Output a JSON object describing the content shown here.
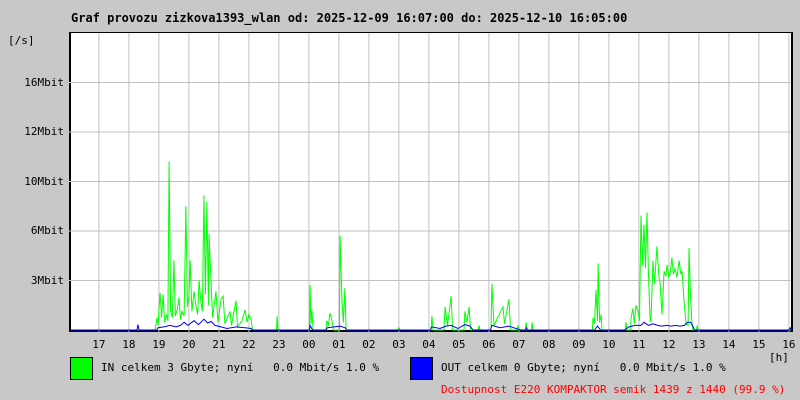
{
  "title": "Graf provozu zizkova1393_wlan od: 2025-12-09 16:07:00 do: 2025-12-10 16:05:00",
  "chart": {
    "y_unit": "[/s]",
    "x_unit": "[h]"
  },
  "legend": {
    "in_label": "IN celkem 3 Gbyte; nyní   0.0 Mbit/s 1.0 %",
    "out_label": "OUT celkem 0 Gbyte; nyní   0.0 Mbit/s 1.0 %",
    "availability": "Dostupnost E220 KOMPAKTOR semik 1439 z 1440 (99.9 %)",
    "in_color": "#00ff00",
    "out_color": "#0000ff",
    "availability_color": "#ff0000"
  },
  "colors": {
    "page_bg": "#c8c8c8",
    "plot_bg": "#ffffff",
    "grid": "#c0c0c0",
    "frame": "#000000"
  },
  "chart_data": {
    "type": "line",
    "title": "Graf provozu zizkova1393_wlan od: 2025-12-09 16:07:00 do: 2025-12-10 16:05:00",
    "xlabel": "[h]",
    "ylabel": "[/s]",
    "xlim_hours": [
      0,
      24
    ],
    "ylim": [
      0,
      19.2
    ],
    "grid": true,
    "grid_color": "#c0c0c0",
    "x_tick_labels": [
      "17",
      "18",
      "19",
      "20",
      "21",
      "22",
      "23",
      "00",
      "01",
      "02",
      "03",
      "04",
      "05",
      "06",
      "07",
      "08",
      "09",
      "10",
      "11",
      "12",
      "13",
      "14",
      "15",
      "16"
    ],
    "x_tick_start_offset_hours": 0.93,
    "x_tick_step_hours": 1,
    "y_ticks": [
      {
        "label": "3Mbit",
        "value": 3.2
      },
      {
        "label": "6Mbit",
        "value": 6.4
      },
      {
        "label": "10Mbit",
        "value": 9.6
      },
      {
        "label": "12Mbit",
        "value": 12.8
      },
      {
        "label": "16Mbit",
        "value": 16.0
      }
    ],
    "series": [
      {
        "name": "IN",
        "color": "#00ff00",
        "unit": "Mbit/s",
        "points": [
          [
            0,
            0
          ],
          [
            2.8,
            0
          ],
          [
            2.87,
            0.8
          ],
          [
            2.9,
            0.3
          ],
          [
            2.97,
            2.4
          ],
          [
            3.02,
            0.8
          ],
          [
            3.07,
            2.3
          ],
          [
            3.12,
            0.5
          ],
          [
            3.18,
            1.0
          ],
          [
            3.23,
            0.6
          ],
          [
            3.27,
            10.9
          ],
          [
            3.32,
            1.2
          ],
          [
            3.38,
            0.8
          ],
          [
            3.43,
            4.5
          ],
          [
            3.48,
            0.9
          ],
          [
            3.55,
            1.4
          ],
          [
            3.6,
            2.1
          ],
          [
            3.65,
            0.7
          ],
          [
            3.7,
            1.2
          ],
          [
            3.77,
            0.9
          ],
          [
            3.83,
            8.0
          ],
          [
            3.88,
            1.5
          ],
          [
            3.93,
            2.2
          ],
          [
            3.97,
            4.5
          ],
          [
            4.03,
            1.2
          ],
          [
            4.1,
            2.5
          ],
          [
            4.17,
            1.5
          ],
          [
            4.22,
            1.0
          ],
          [
            4.27,
            3.2
          ],
          [
            4.33,
            1.8
          ],
          [
            4.38,
            1.2
          ],
          [
            4.43,
            8.7
          ],
          [
            4.48,
            2.3
          ],
          [
            4.53,
            8.3
          ],
          [
            4.58,
            1.6
          ],
          [
            4.6,
            6.2
          ],
          [
            4.67,
            3.0
          ],
          [
            4.72,
            0.8
          ],
          [
            4.83,
            2.5
          ],
          [
            4.9,
            0.5
          ],
          [
            5.0,
            2.0
          ],
          [
            5.07,
            2.2
          ],
          [
            5.13,
            0.4
          ],
          [
            5.3,
            1.2
          ],
          [
            5.35,
            0.3
          ],
          [
            5.5,
            1.9
          ],
          [
            5.55,
            0.2
          ],
          [
            5.7,
            0.6
          ],
          [
            5.8,
            1.3
          ],
          [
            5.87,
            0.5
          ],
          [
            5.93,
            1.0
          ],
          [
            6.0,
            0.7
          ],
          [
            6.05,
            0
          ],
          [
            6.85,
            0
          ],
          [
            6.87,
            0.9
          ],
          [
            6.9,
            0
          ],
          [
            7.95,
            0
          ],
          [
            7.97,
            2.9
          ],
          [
            8.0,
            0.4
          ],
          [
            8.03,
            1.3
          ],
          [
            8.07,
            0
          ],
          [
            8.5,
            0
          ],
          [
            8.53,
            0.6
          ],
          [
            8.58,
            0.3
          ],
          [
            8.63,
            1.1
          ],
          [
            8.7,
            0.6
          ],
          [
            8.75,
            0
          ],
          [
            8.95,
            0
          ],
          [
            8.97,
            6.1
          ],
          [
            9.03,
            2.0
          ],
          [
            9.08,
            0.5
          ],
          [
            9.13,
            2.7
          ],
          [
            9.17,
            0
          ],
          [
            10.9,
            0
          ],
          [
            10.93,
            0.15
          ],
          [
            10.97,
            0
          ],
          [
            12.0,
            0
          ],
          [
            12.03,
            0.9
          ],
          [
            12.07,
            0
          ],
          [
            12.43,
            0
          ],
          [
            12.47,
            1.5
          ],
          [
            12.55,
            0.3
          ],
          [
            12.67,
            2.2
          ],
          [
            12.72,
            0
          ],
          [
            13.1,
            0
          ],
          [
            13.13,
            1.2
          ],
          [
            13.2,
            0.5
          ],
          [
            13.27,
            1.5
          ],
          [
            13.32,
            0
          ],
          [
            13.57,
            0
          ],
          [
            13.6,
            0.3
          ],
          [
            13.63,
            0
          ],
          [
            14.0,
            0
          ],
          [
            14.03,
            3.0
          ],
          [
            14.1,
            0.3
          ],
          [
            14.4,
            1.5
          ],
          [
            14.45,
            0.4
          ],
          [
            14.6,
            2.0
          ],
          [
            14.65,
            0
          ],
          [
            14.87,
            0
          ],
          [
            14.9,
            0.3
          ],
          [
            14.93,
            0
          ],
          [
            15.15,
            0
          ],
          [
            15.17,
            0.5
          ],
          [
            15.2,
            0
          ],
          [
            15.35,
            0
          ],
          [
            15.37,
            0.5
          ],
          [
            15.4,
            0
          ],
          [
            17.38,
            0
          ],
          [
            17.4,
            0.8
          ],
          [
            17.45,
            0.4
          ],
          [
            17.5,
            2.6
          ],
          [
            17.55,
            0.6
          ],
          [
            17.57,
            4.3
          ],
          [
            17.62,
            0.5
          ],
          [
            17.67,
            1.0
          ],
          [
            17.7,
            0
          ],
          [
            18.47,
            0
          ],
          [
            18.5,
            0.5
          ],
          [
            18.53,
            0
          ],
          [
            18.65,
            0
          ],
          [
            18.67,
            0.8
          ],
          [
            18.73,
            1.4
          ],
          [
            18.78,
            0.4
          ],
          [
            18.83,
            1.6
          ],
          [
            18.9,
            1.2
          ],
          [
            18.95,
            0.6
          ],
          [
            19.0,
            7.4
          ],
          [
            19.05,
            4.2
          ],
          [
            19.1,
            6.8
          ],
          [
            19.15,
            4.0
          ],
          [
            19.2,
            7.6
          ],
          [
            19.25,
            3.5
          ],
          [
            19.3,
            0.8
          ],
          [
            19.33,
            0.5
          ],
          [
            19.4,
            4.5
          ],
          [
            19.45,
            3.0
          ],
          [
            19.53,
            5.4
          ],
          [
            19.6,
            3.4
          ],
          [
            19.63,
            3.2
          ],
          [
            19.7,
            1.0
          ],
          [
            19.77,
            3.8
          ],
          [
            19.83,
            3.5
          ],
          [
            19.87,
            4.2
          ],
          [
            19.93,
            3.4
          ],
          [
            19.97,
            3.6
          ],
          [
            20.03,
            4.7
          ],
          [
            20.08,
            3.6
          ],
          [
            20.13,
            4.0
          ],
          [
            20.2,
            3.4
          ],
          [
            20.27,
            4.5
          ],
          [
            20.33,
            3.6
          ],
          [
            20.37,
            3.8
          ],
          [
            20.43,
            2.0
          ],
          [
            20.5,
            0.4
          ],
          [
            20.57,
            0.3
          ],
          [
            20.6,
            5.3
          ],
          [
            20.65,
            2.2
          ],
          [
            20.7,
            0.4
          ],
          [
            20.73,
            0
          ],
          [
            20.85,
            0
          ],
          [
            20.87,
            0.3
          ],
          [
            20.9,
            0
          ],
          [
            24,
            0
          ]
        ]
      },
      {
        "name": "OUT",
        "color": "#0000ff",
        "unit": "Mbit/s",
        "points": [
          [
            0,
            0
          ],
          [
            2.2,
            0
          ],
          [
            2.23,
            0.35
          ],
          [
            2.27,
            0
          ],
          [
            2.85,
            0
          ],
          [
            2.9,
            0.15
          ],
          [
            3.1,
            0.2
          ],
          [
            3.3,
            0.3
          ],
          [
            3.5,
            0.2
          ],
          [
            3.65,
            0.3
          ],
          [
            3.77,
            0.5
          ],
          [
            3.9,
            0.3
          ],
          [
            4.1,
            0.6
          ],
          [
            4.25,
            0.35
          ],
          [
            4.43,
            0.7
          ],
          [
            4.55,
            0.45
          ],
          [
            4.67,
            0.55
          ],
          [
            4.8,
            0.3
          ],
          [
            5.0,
            0.2
          ],
          [
            5.2,
            0.1
          ],
          [
            5.5,
            0.2
          ],
          [
            5.8,
            0.15
          ],
          [
            6.0,
            0.1
          ],
          [
            6.05,
            0
          ],
          [
            7.95,
            0
          ],
          [
            7.97,
            0.3
          ],
          [
            8.05,
            0
          ],
          [
            8.5,
            0
          ],
          [
            8.55,
            0.15
          ],
          [
            8.97,
            0.25
          ],
          [
            9.13,
            0.15
          ],
          [
            9.2,
            0
          ],
          [
            11.98,
            0
          ],
          [
            12.03,
            0.2
          ],
          [
            12.3,
            0.1
          ],
          [
            12.5,
            0.25
          ],
          [
            12.67,
            0.3
          ],
          [
            12.9,
            0.1
          ],
          [
            13.13,
            0.35
          ],
          [
            13.3,
            0.25
          ],
          [
            13.4,
            0
          ],
          [
            13.98,
            0
          ],
          [
            14.03,
            0.3
          ],
          [
            14.3,
            0.15
          ],
          [
            14.6,
            0.25
          ],
          [
            14.9,
            0.05
          ],
          [
            15.0,
            0
          ],
          [
            15.15,
            0
          ],
          [
            15.18,
            0.15
          ],
          [
            15.22,
            0
          ],
          [
            17.45,
            0
          ],
          [
            17.55,
            0.25
          ],
          [
            17.65,
            0
          ],
          [
            18.45,
            0
          ],
          [
            18.6,
            0.2
          ],
          [
            18.8,
            0.3
          ],
          [
            19.0,
            0.3
          ],
          [
            19.1,
            0.5
          ],
          [
            19.25,
            0.3
          ],
          [
            19.4,
            0.4
          ],
          [
            19.55,
            0.3
          ],
          [
            19.7,
            0.25
          ],
          [
            19.85,
            0.3
          ],
          [
            20.0,
            0.25
          ],
          [
            20.15,
            0.3
          ],
          [
            20.3,
            0.25
          ],
          [
            20.45,
            0.3
          ],
          [
            20.55,
            0.5
          ],
          [
            20.65,
            0.5
          ],
          [
            20.72,
            0.3
          ],
          [
            20.78,
            0
          ],
          [
            23.93,
            0
          ],
          [
            23.97,
            0.15
          ],
          [
            24,
            0
          ]
        ]
      }
    ]
  }
}
